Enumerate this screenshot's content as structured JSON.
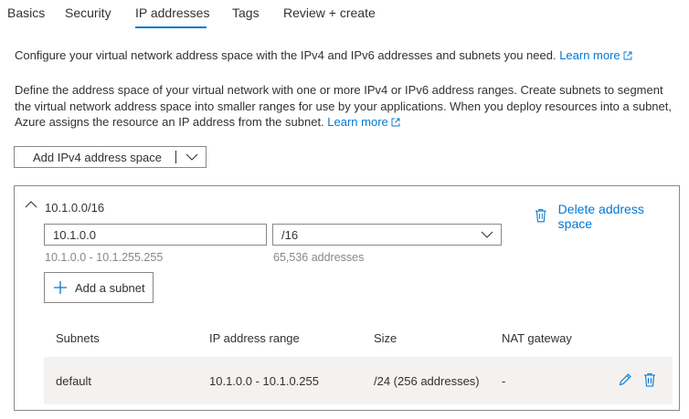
{
  "tabs": [
    {
      "label": "Basics",
      "active": false
    },
    {
      "label": "Security",
      "active": false
    },
    {
      "label": "IP addresses",
      "active": true
    },
    {
      "label": "Tags",
      "active": false
    },
    {
      "label": "Review + create",
      "active": false
    }
  ],
  "intro": {
    "text": "Configure your virtual network address space with the IPv4 and IPv6 addresses and subnets you need. ",
    "link": "Learn more"
  },
  "description": {
    "text": "Define the address space of your virtual network with one or more IPv4 or IPv6 address ranges. Create subnets to segment the virtual network address space into smaller ranges for use by your applications. When you deploy resources into a subnet, Azure assigns the resource an IP address from the subnet. ",
    "link": "Learn more"
  },
  "add_space_button": {
    "label": "Add IPv4 address space"
  },
  "address_space": {
    "title": "10.1.0.0/16",
    "delete_label": "Delete address space",
    "address_value": "10.1.0.0",
    "prefix_value": "/16",
    "range_hint": "10.1.0.0 - 10.1.255.255",
    "count_hint": "65,536 addresses",
    "add_subnet_label": "Add a subnet"
  },
  "subnets_table": {
    "columns": [
      "Subnets",
      "IP address range",
      "Size",
      "NAT gateway"
    ],
    "rows": [
      {
        "name": "default",
        "range": "10.1.0.0 - 10.1.0.255",
        "size": "/24 (256 addresses)",
        "nat": "-"
      }
    ]
  },
  "colors": {
    "accent": "#0078d4",
    "text": "#323130",
    "muted": "#8a8886",
    "row_bg": "#f3f2f1"
  },
  "icons": [
    "external-link-icon",
    "chevron-down-icon",
    "chevron-up-icon",
    "trash-icon",
    "plus-icon",
    "edit-icon"
  ]
}
